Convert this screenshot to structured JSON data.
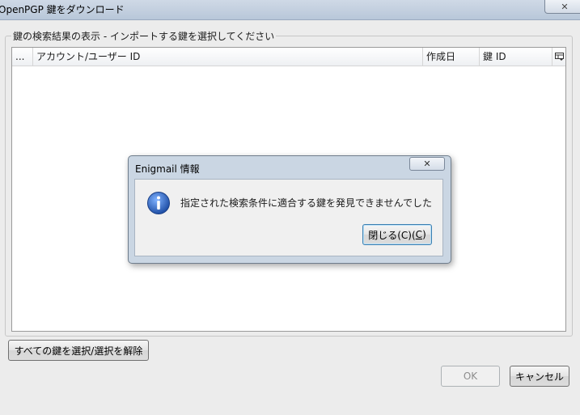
{
  "window": {
    "title": "OpenPGP 鍵をダウンロード",
    "close_glyph": "✕"
  },
  "group": {
    "label": "鍵の検索結果の表示 - インポートする鍵を選択してください"
  },
  "tree": {
    "columns": [
      {
        "label": "..."
      },
      {
        "label": "アカウント/ユーザー ID"
      },
      {
        "label": "作成日"
      },
      {
        "label": "鍵 ID"
      }
    ],
    "picker_icon": "column-picker-icon"
  },
  "buttons": {
    "select_all": "すべての鍵を選択/選択を解除",
    "ok": "OK",
    "cancel": "キャンセル"
  },
  "dialog": {
    "title": "Enigmail 情報",
    "close_glyph": "✕",
    "message": "指定された検索条件に適合する鍵を発見できませんでした",
    "close_button_prefix": "閉じる(C)(",
    "close_button_key": "C",
    "close_button_suffix": ")"
  },
  "colors": {
    "info_icon": "#2b5fb4",
    "titlebar": "#c4d1e1"
  }
}
